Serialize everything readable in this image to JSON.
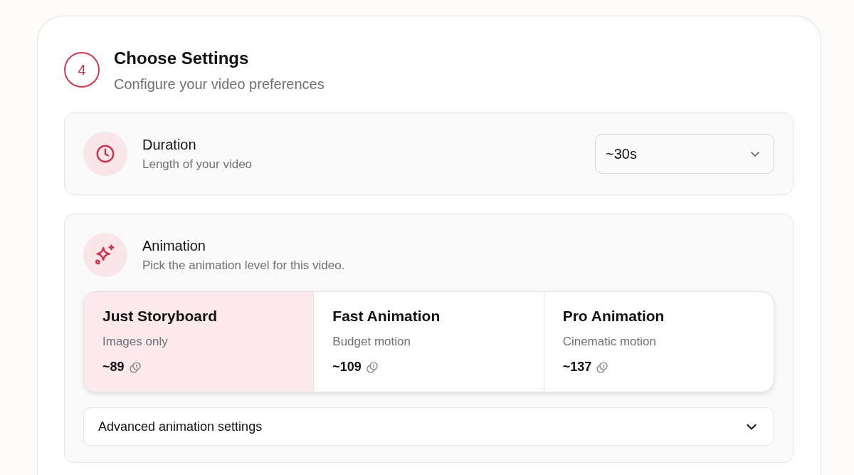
{
  "step": {
    "number": "4",
    "title": "Choose Settings",
    "subtitle": "Configure your video preferences"
  },
  "duration": {
    "title": "Duration",
    "description": "Length of your video",
    "value": "~30s"
  },
  "animation": {
    "title": "Animation",
    "description": "Pick the animation level for this video.",
    "options": [
      {
        "name": "Just Storyboard",
        "detail": "Images only",
        "cost": "~89",
        "selected": true
      },
      {
        "name": "Fast Animation",
        "detail": "Budget motion",
        "cost": "~109",
        "selected": false
      },
      {
        "name": "Pro Animation",
        "detail": "Cinematic motion",
        "cost": "~137",
        "selected": false
      }
    ],
    "advanced": {
      "label": "Advanced animation settings",
      "expanded": false
    }
  }
}
